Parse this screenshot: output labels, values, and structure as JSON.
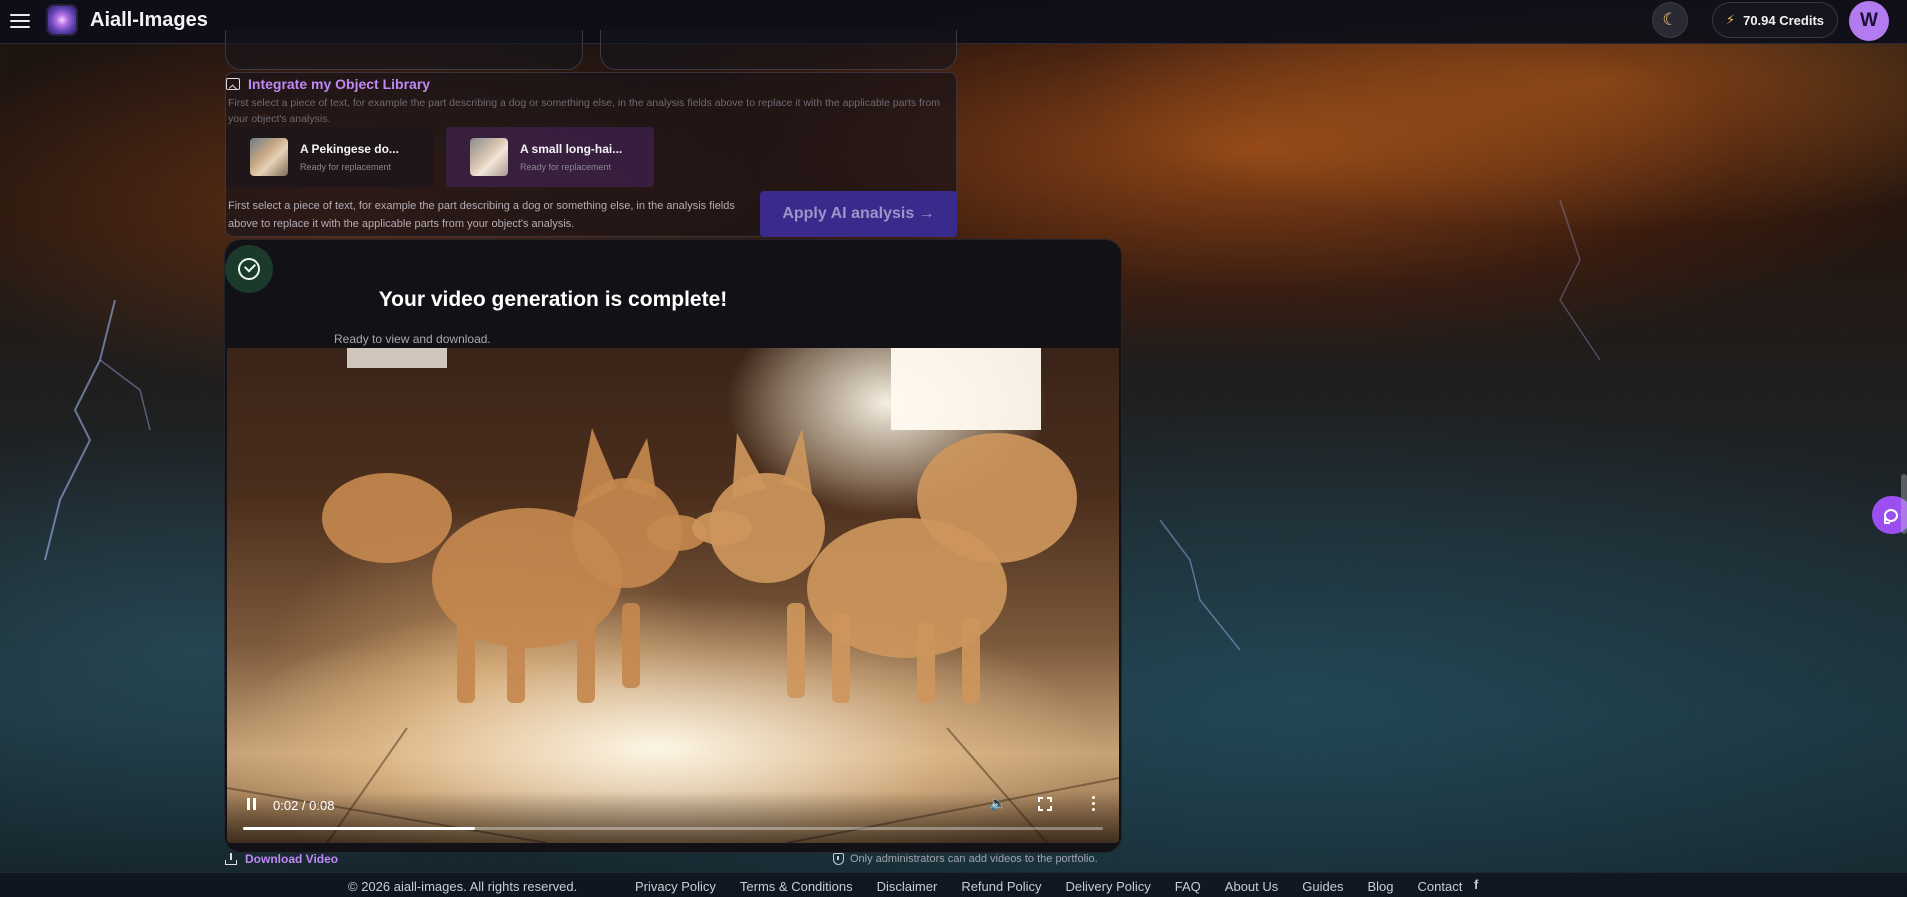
{
  "header": {
    "brand": "Aiall-Images",
    "theme_icon": "moon-icon",
    "credits": "70.94 Credits",
    "avatar_initial": "W"
  },
  "object_library": {
    "title": "Integrate my Object Library",
    "hint": "First select a piece of text, for example the part describing a dog or something else, in the analysis fields above to replace it with the applicable parts from your object's analysis.",
    "objects": [
      {
        "name": "A Pekingese do...",
        "status": "Ready for replacement"
      },
      {
        "name": "A small long-hai...",
        "status": "Ready for replacement"
      }
    ],
    "hint2": "First select a piece of text, for example the part describing a dog or something else, in the analysis fields above to replace it with the applicable parts from your object's analysis.",
    "apply_button": "Apply AI analysis →"
  },
  "result": {
    "title": "Your video generation is complete!",
    "subtitle": "Ready to view and download.",
    "video": {
      "time": "0:02 / 0:08",
      "progress": 0.27
    },
    "download_label": "Download Video",
    "admin_note": "Only administrators can add videos to the portfolio."
  },
  "footer": {
    "copyright": "© 2026 aiall-images. All rights reserved.",
    "links": [
      "Privacy Policy",
      "Terms & Conditions",
      "Disclaimer",
      "Refund Policy",
      "Delivery Policy",
      "FAQ",
      "About Us",
      "Guides",
      "Blog",
      "Contact"
    ],
    "social_icon": "facebook-icon"
  },
  "colors": {
    "accent": "#c189f5",
    "apply_button": "#3a2a8c",
    "avatar": "#b27cf0",
    "chat_button": "#9b4ff0"
  }
}
